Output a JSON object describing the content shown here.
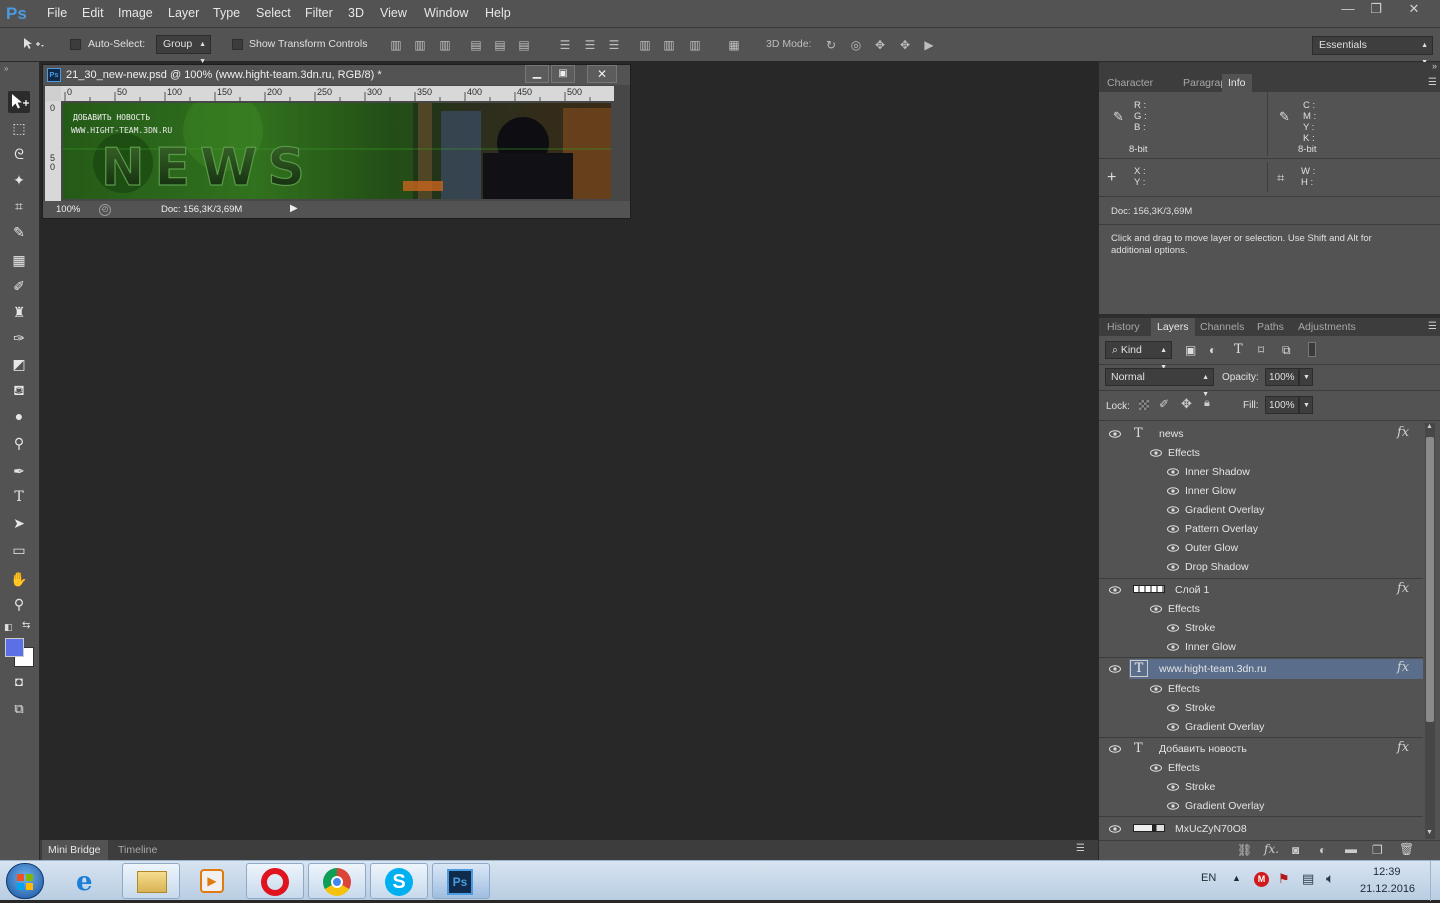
{
  "app": {
    "logo": "Ps",
    "menu": [
      "File",
      "Edit",
      "Image",
      "Layer",
      "Type",
      "Select",
      "Filter",
      "3D",
      "View",
      "Window",
      "Help"
    ],
    "window_controls": {
      "minimize": "—",
      "restore": "❐",
      "close": "✕"
    }
  },
  "options_bar": {
    "auto_select_label": "Auto-Select:",
    "auto_select_value": "Group",
    "show_transform_label": "Show Transform Controls",
    "mode_3d_label": "3D Mode:",
    "workspace": "Essentials"
  },
  "document": {
    "title": "21_30_new-new.psd @ 100% (www.hight-team.3dn.ru, RGB/8) *",
    "ruler_h": [
      "0",
      "50",
      "100",
      "150",
      "200",
      "250",
      "300",
      "350",
      "400",
      "450",
      "500"
    ],
    "ruler_v": [
      "0",
      "5",
      "0"
    ],
    "banner_line1": "ДОБАВИТЬ НОВОСТЬ",
    "banner_line2": "WWW.HIGHT-TEAM.3DN.RU",
    "banner_big": "NEWS",
    "zoom": "100%",
    "doc_info": "Doc: 156,3K/3,69M"
  },
  "info_panel": {
    "tabs": [
      "Character",
      "Paragraph",
      "Info"
    ],
    "active_tab": "Info",
    "rgb_labels": [
      "R :",
      "G :",
      "B :"
    ],
    "rgb_bit": "8-bit",
    "cmyk_labels": [
      "C :",
      "M :",
      "Y :",
      "K :"
    ],
    "cmyk_bit": "8-bit",
    "xy_labels": [
      "X :",
      "Y :"
    ],
    "wh_labels": [
      "W :",
      "H :"
    ],
    "doc_info": "Doc: 156,3K/3,69M",
    "hint": "Click and drag to move layer or selection.  Use Shift and Alt for additional options."
  },
  "layers_panel": {
    "tabs": [
      "History",
      "Layers",
      "Channels",
      "Paths",
      "Adjustments"
    ],
    "active_tab": "Layers",
    "filter_kind": "Kind",
    "blend_mode": "Normal",
    "opacity_label": "Opacity:",
    "opacity_value": "100%",
    "lock_label": "Lock:",
    "fill_label": "Fill:",
    "fill_value": "100%",
    "layers": [
      {
        "name": "news",
        "type": "text",
        "effects_label": "Effects",
        "effects": [
          "Inner Shadow",
          "Inner Glow",
          "Gradient Overlay",
          "Pattern Overlay",
          "Outer Glow",
          "Drop Shadow"
        ]
      },
      {
        "name": "Слой 1",
        "type": "raster",
        "effects_label": "Effects",
        "effects": [
          "Stroke",
          "Inner Glow"
        ]
      },
      {
        "name": "www.hight-team.3dn.ru",
        "type": "text",
        "selected": true,
        "effects_label": "Effects",
        "effects": [
          "Stroke",
          "Gradient Overlay"
        ]
      },
      {
        "name": "Добавить новость",
        "type": "text",
        "effects_label": "Effects",
        "effects": [
          "Stroke",
          "Gradient Overlay"
        ]
      },
      {
        "name": "MxUcZyN70O8",
        "type": "raster",
        "effects": []
      }
    ]
  },
  "bottom_panel": {
    "tabs": [
      "Mini Bridge",
      "Timeline"
    ]
  },
  "taskbar": {
    "language": "EN",
    "time": "12:39",
    "date": "21.12.2016"
  },
  "colors": {
    "app_bg": "#282828",
    "panel": "#535353",
    "selected_layer": "#5a6e8c",
    "foreground_swatch": "#5b6fe6",
    "ps_blue": "#4a9be0"
  }
}
